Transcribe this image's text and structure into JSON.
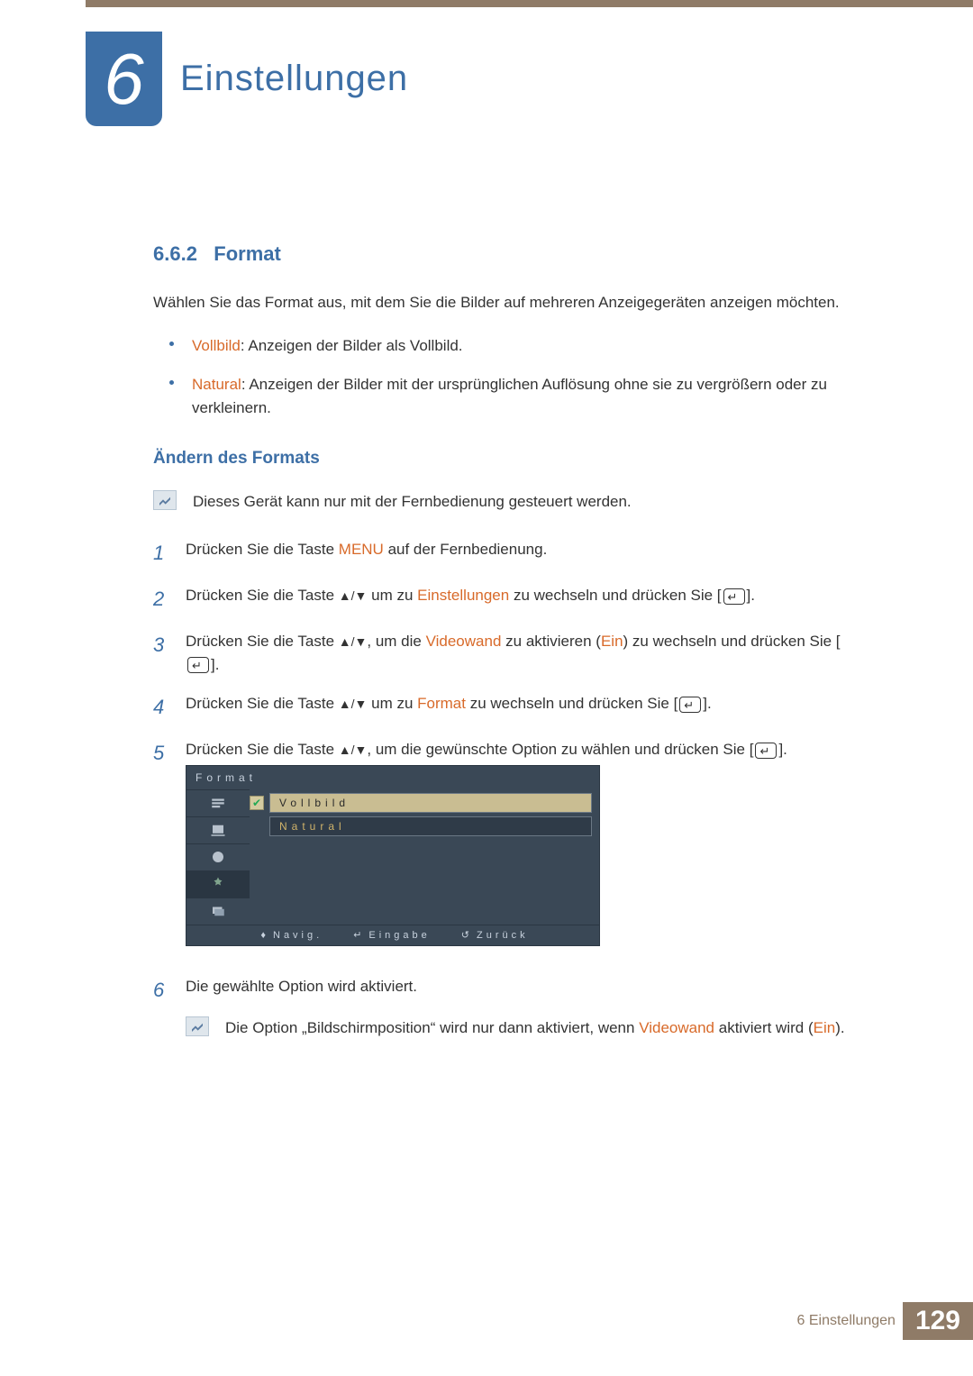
{
  "chapter": {
    "number": "6",
    "title": "Einstellungen"
  },
  "section": {
    "number": "6.6.2",
    "title": "Format"
  },
  "intro": "Wählen Sie das Format aus, mit dem Sie die Bilder auf mehreren Anzeigegeräten anzeigen möchten.",
  "bullets": [
    {
      "term": "Vollbild",
      "desc": ": Anzeigen der Bilder als Vollbild."
    },
    {
      "term": "Natural",
      "desc": ": Anzeigen der Bilder mit der ursprünglichen Auflösung ohne sie zu vergrößern oder zu verkleinern."
    }
  ],
  "subhead": "Ändern des Formats",
  "note1": "Dieses Gerät kann nur mit der Fernbedienung gesteuert werden.",
  "steps": {
    "s1a": "Drücken Sie die Taste ",
    "s1m": "MENU",
    "s1b": " auf der Fernbedienung.",
    "s2a": "Drücken Sie die Taste ",
    "s2b": " um zu ",
    "s2t": "Einstellungen",
    "s2c": " zu wechseln und drücken Sie [",
    "s2d": "].",
    "s3a": "Drücken Sie die Taste ",
    "s3b": ", um die ",
    "s3t": "Videowand",
    "s3c": " zu aktivieren (",
    "s3on": "Ein",
    "s3d": ") zu wechseln und drücken Sie [",
    "s3e": "].",
    "s4a": "Drücken Sie die Taste ",
    "s4b": " um zu ",
    "s4t": "Format",
    "s4c": " zu wechseln und drücken Sie [",
    "s4d": "].",
    "s5a": "Drücken Sie die Taste ",
    "s5b": ", um die gewünschte Option zu wählen und drücken Sie [",
    "s5c": "].",
    "s6": "Die gewählte Option wird aktiviert."
  },
  "osd": {
    "title": "Format",
    "opt1": "Vollbild",
    "opt2": "Natural",
    "nav": "Navig.",
    "enter": "Eingabe",
    "back": "Zurück"
  },
  "note2a": "Die Option „Bildschirmposition“ wird nur dann aktiviert, wenn ",
  "note2t": "Videowand",
  "note2b": " aktiviert wird (",
  "note2on": "Ein",
  "note2c": ").",
  "footer": {
    "label": "6 Einstellungen",
    "page": "129"
  },
  "arrows": "▲/▼"
}
